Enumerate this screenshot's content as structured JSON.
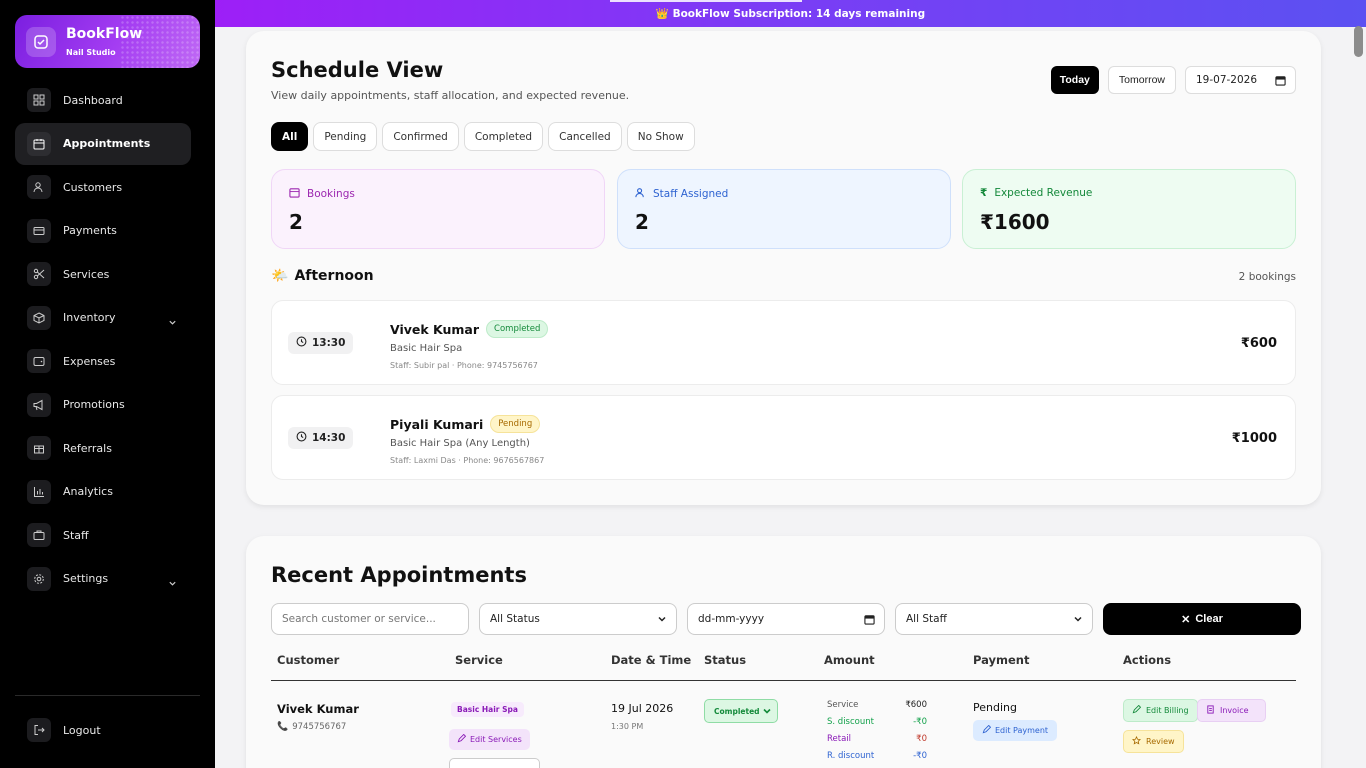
{
  "brand": {
    "name": "BookFlow",
    "subtitle": "Nail Studio"
  },
  "banner": {
    "text": "👑 BookFlow Subscription: 14 days remaining"
  },
  "nav": {
    "items": [
      {
        "label": "Dashboard",
        "icon": "dashboard-icon"
      },
      {
        "label": "Appointments",
        "icon": "calendar-icon",
        "active": true
      },
      {
        "label": "Customers",
        "icon": "users-icon"
      },
      {
        "label": "Payments",
        "icon": "credit-card-icon"
      },
      {
        "label": "Services",
        "icon": "scissors-icon"
      },
      {
        "label": "Inventory",
        "icon": "box-icon",
        "expandable": true
      },
      {
        "label": "Expenses",
        "icon": "wallet-icon"
      },
      {
        "label": "Promotions",
        "icon": "megaphone-icon"
      },
      {
        "label": "Referrals",
        "icon": "gift-icon"
      },
      {
        "label": "Analytics",
        "icon": "chart-icon"
      },
      {
        "label": "Staff",
        "icon": "briefcase-icon"
      },
      {
        "label": "Settings",
        "icon": "gear-icon",
        "expandable": true
      }
    ],
    "logout": "Logout"
  },
  "schedule": {
    "title": "Schedule View",
    "subtitle": "View daily appointments, staff allocation, and expected revenue.",
    "today_label": "Today",
    "tomorrow_label": "Tomorrow",
    "date_value": "19-07-2026",
    "filters": [
      "All",
      "Pending",
      "Confirmed",
      "Completed",
      "Cancelled",
      "No Show"
    ],
    "active_filter": "All",
    "stats": {
      "bookings_label": "Bookings",
      "bookings_value": "2",
      "staff_label": "Staff Assigned",
      "staff_value": "2",
      "revenue_label": "Expected Revenue",
      "revenue_value": "₹1600"
    },
    "section": {
      "emoji": "🌤️",
      "title": "Afternoon",
      "count": "2 bookings"
    },
    "appointments": [
      {
        "time": "13:30",
        "name": "Vivek Kumar",
        "status": "Completed",
        "service": "Basic Hair Spa",
        "meta": "Staff: Subir pal · Phone: 9745756767",
        "amount": "₹600"
      },
      {
        "time": "14:30",
        "name": "Piyali Kumari",
        "status": "Pending",
        "service": "Basic Hair Spa (Any Length)",
        "meta": "Staff: Laxmi Das · Phone: 9676567867",
        "amount": "₹1000"
      }
    ]
  },
  "recent": {
    "title": "Recent Appointments",
    "search_placeholder": "Search customer or service...",
    "status_select": "All Status",
    "date_placeholder": "dd-mm-yyyy",
    "staff_select": "All Staff",
    "clear_label": "Clear",
    "columns": [
      "Customer",
      "Service",
      "Date & Time",
      "Status",
      "Amount",
      "Payment",
      "Actions"
    ],
    "row": {
      "customer": "Vivek Kumar",
      "phone": "9745756767",
      "service_tag": "Basic Hair Spa",
      "edit_services": "Edit Services",
      "date": "19 Jul 2026",
      "time": "1:30 PM",
      "status": "Completed",
      "amounts": [
        {
          "k": "Service",
          "v": "₹600"
        },
        {
          "k": "S. discount",
          "v": "-₹0"
        },
        {
          "k": "Retail",
          "v": "₹0"
        },
        {
          "k": "R. discount",
          "v": "-₹0"
        }
      ],
      "payment_status": "Pending",
      "edit_payment": "Edit Payment",
      "actions": {
        "billing": "Edit Billing",
        "invoice": "Invoice",
        "review": "Review"
      }
    }
  },
  "colors": {
    "accent": "#9d1ff7",
    "sidebar_bg": "#000000",
    "success": "#148a3b",
    "pending": "#a76a00"
  }
}
